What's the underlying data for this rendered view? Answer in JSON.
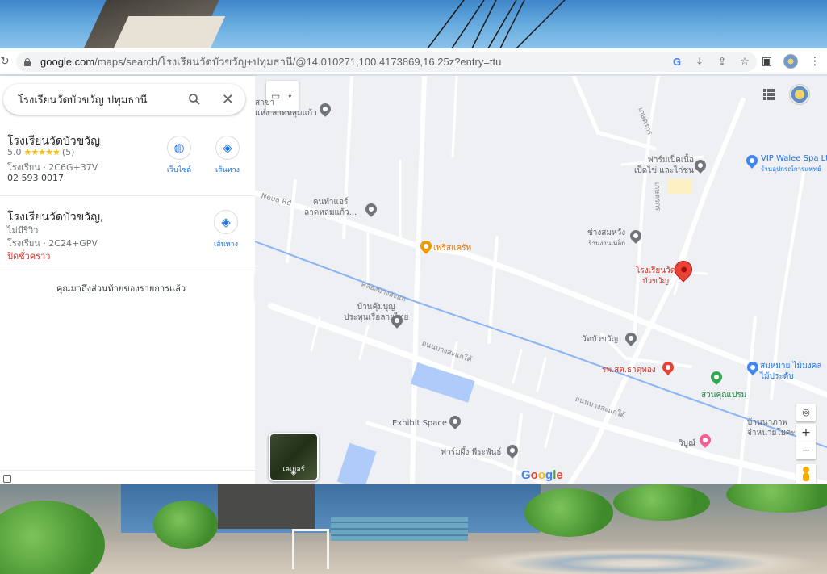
{
  "browser": {
    "url_host": "google.com",
    "url_path": "/maps/search/โรงเรียนวัดบัวขวัญ+ปทุมธานี/@14.010271,100.4173869,16.25z?entry=ttu"
  },
  "search": {
    "value": "โรงเรียนวัดบัวขวัญ ปทุมธานี"
  },
  "results": [
    {
      "title": "โรงเรียนวัดบัวขวัญ",
      "rating": "5.0",
      "stars": "★★★★★",
      "reviews": "(5)",
      "category_code": "โรงเรียน · 2C6G+37V",
      "phone": "02 593 0017",
      "website_label": "เว็บไซต์",
      "directions_label": "เส้นทาง"
    },
    {
      "title": "โรงเรียนวัดบัวขวัญ,",
      "no_reviews": "ไม่มีรีวิว",
      "category_code": "โรงเรียน · 2C24+GPV",
      "status": "ปิดชั่วคราว",
      "directions_label": "เส้นทาง"
    }
  ],
  "end_of_list": "คุณมาถึงส่วนท้ายของรายการแล้ว",
  "map": {
    "labels": {
      "l1": "สาขา",
      "l1b": "แห่ง ลาดหลุมแก้ว",
      "l2": "ฟาร์มเป็ดเนื้อ",
      "l2b": "เป็ดไข่ และไก่ชน",
      "l3": "VIP Walee Spa Lt",
      "l3b": "ร้านอุปกรณ์การแพทย์",
      "l4": "คนทำแอร์",
      "l4b": "ลาดหลุมแก้ว...",
      "l5": "ช่างสมหวัง",
      "l5b": "ร้านงานเหล็ก",
      "l6": "เฟรีสแครัท",
      "l7": "โรงเรียนวัด",
      "l7b": "บัวขวัญ",
      "l8": "บ้านคุ้มบุญ",
      "l8b": "ประทุนเรือลายไทย",
      "l9": "วัดบัวขวัญ",
      "l10": "รพ.สต.ธาตุทอง",
      "l11": "สมหมาย ไม้มงคล",
      "l11b": "ไม้ประดับ",
      "l12": "สวนคุณเปรม",
      "l13": "Exhibit Space",
      "l14": "ฟาร์มผึ้ง พีระพันธ์",
      "l15": "วิบูณ์",
      "l16": "บ้านนาภาพ",
      "l16b": "จำหน่ายโยคะ",
      "road1": "Neua Rd",
      "road2": "คลองบางสะแก",
      "road3": "ถนนบางสะแกใต้",
      "road4": "ถนนบางสะแกใต้",
      "road5": "เกษตรกร",
      "road6": "เกษตรกร"
    },
    "layers_label": "เลเยอร์",
    "zoom_in": "+",
    "zoom_out": "−",
    "logo": "Google"
  },
  "colors": {
    "accent": "#1a73e8",
    "pin": "#ea4335",
    "closed": "#d93025",
    "stars": "#fbbc04"
  },
  "icons": [
    "reload-icon",
    "lock-icon",
    "google-lens-icon",
    "install-icon",
    "share-icon",
    "star-icon",
    "sidepanel-icon",
    "menu-icon",
    "search-icon",
    "close-icon",
    "website-icon",
    "directions-icon",
    "keyboard-icon",
    "apps-icon",
    "layers-icon",
    "my-location-icon",
    "pegman-icon"
  ]
}
